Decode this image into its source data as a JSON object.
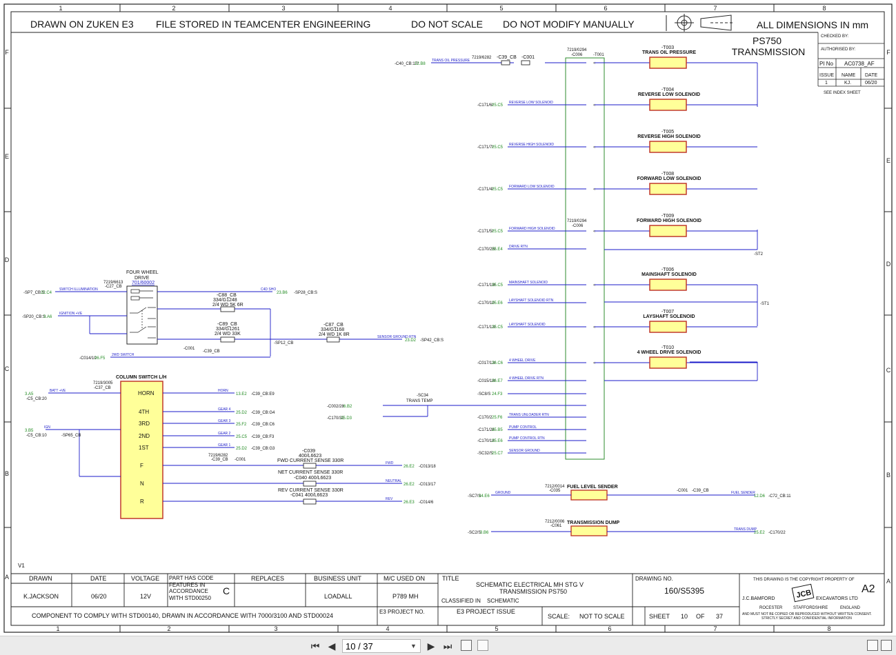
{
  "header": {
    "drawn_on": "DRAWN ON ZUKEN E3",
    "file_stored": "FILE STORED IN TEAMCENTER ENGINEERING",
    "do_not_scale": "DO NOT SCALE",
    "do_not_modify": "DO NOT MODIFY MANUALLY",
    "dimensions": "ALL DIMENSIONS IN mm"
  },
  "grid": {
    "cols": [
      "1",
      "2",
      "3",
      "4",
      "5",
      "6",
      "7",
      "8"
    ],
    "rows": [
      "F",
      "E",
      "D",
      "C",
      "B",
      "A"
    ]
  },
  "title_block": {
    "drawing_title_1": "PS750",
    "drawing_title_2": "TRANSMISSION",
    "checked_by": "CHECKED BY:",
    "authorised_by": "AUTHORISED BY:",
    "pi_no_label": "PI No",
    "pi_no": "AC0738_AF",
    "issue_label": "ISSUE",
    "name_label": "NAME",
    "date_label": "DATE",
    "issue": "1",
    "name": "KJ.",
    "date": "06/20",
    "see_index": "SEE INDEX SHEET",
    "drawn_label": "DRAWN",
    "date_col_label": "DATE",
    "voltage_label": "VOLTAGE",
    "part_code": "PART HAS CODE FEATURES IN ACCORDANCE WITH STD00250",
    "part_code_letter": "C",
    "replaces_label": "REPLACES",
    "business_unit_label": "BUSINESS UNIT",
    "mc_used_label": "M/C USED ON",
    "title_label": "TITLE",
    "drawn": "K.JACKSON",
    "drawn_date": "06/20",
    "voltage": "12V",
    "business_unit": "LOADALL",
    "mc_used": "P789 MH",
    "title_1": "SCHEMATIC ELECTRICAL MH STG V",
    "title_2": "TRANSMISSION PS750",
    "classified_in": "CLASSIFIED IN",
    "classified": "SCHEMATIC",
    "drawing_no_label": "DRAWING NO.",
    "drawing_no": "160/S5395",
    "sheet_size": "A2",
    "comply": "COMPONENT TO COMPLY WITH STD00140, DRAWN IN ACCORDANCE WITH 7000/3100 AND STD00024",
    "e3_project_no": "E3 PROJECT NO.",
    "e3_project_issue": "E3 PROJECT ISSUE",
    "scale_label": "SCALE:",
    "scale": "NOT TO SCALE",
    "sheet_label": "SHEET",
    "sheet": "10",
    "of_label": "OF",
    "sheet_total": "37",
    "copyright": "THIS DRAWING IS THE COPYRIGHT PROPERTY OF",
    "company_1": "J.C.BAMFORD",
    "company_2": "EXCAVATORS LTD",
    "address_1": "ROCESTER",
    "address_2": "STAFFORDSHIRE",
    "address_3": "ENGLAND",
    "notice_1": "AND MUST NOT BE COPIED OR REPRODUCED WITHOUT WRITTEN CONSENT.",
    "notice_2": "STRICTLY SECRET AND CONFIDENTIAL INFORMATION",
    "version": "V1",
    "logo_text": "JCB"
  },
  "components": {
    "c006_part": "7219/0294",
    "c006": "-C006",
    "t001": "-T001",
    "c006b_part": "7219/0294",
    "c006b": "-C006",
    "four_wheel_drive_1": "FOUR WHEEL",
    "four_wheel_drive_2": "DRIVE",
    "four_wheel_drive_ref": "701/60002",
    "c27_part": "7219/6613",
    "c27": "-C27_CB",
    "c88": "-C88_CB",
    "c88_part": "334/G1248",
    "c88_desc": "2/4 WD 5K 6R",
    "c89": "-C89_CB",
    "c89_part": "334/G1261",
    "c89_desc": "2/4 WD 33K",
    "c87": "-C87_CB",
    "c87_part": "334/G1168",
    "c87_desc": "2/4 WD 1K 8R",
    "column_switch": "COLUMN SWITCH L/H",
    "c37_part": "7219/3005",
    "c37": "-C37_CB",
    "cs_labels": [
      "HORN",
      "4TH",
      "3RD",
      "2ND",
      "1ST",
      "F",
      "N",
      "R"
    ],
    "c039": "-C039",
    "c039_part": "400/L6623",
    "c039_desc": "FWD CURRENT SENSE 330R",
    "c040_desc": "NET CURRENT SENSE 330R",
    "c040": "-C040  400/L6623",
    "c041": "REV CURRENT SENSE 330R",
    "c041_part": "-C041  400/L6623",
    "sc34": "-SC34",
    "trans_temp": "TRANS TEMP",
    "fuel_level": "FUEL LEVEL SENDER",
    "c035_part": "7212/0014",
    "c035": "-C035",
    "trans_dump": "TRANSMISSION DUMP",
    "c061_part": "7212/0006",
    "c061": "-C061",
    "c39_cb": "-C39_CB",
    "c001": "-C001"
  },
  "solenoids": [
    {
      "id": "-T003",
      "name": "TRANS OIL PRESSURE"
    },
    {
      "id": "-T004",
      "name": "REVERSE LOW SOLENOID"
    },
    {
      "id": "-T005",
      "name": "REVERSE HIGH SOLENOID"
    },
    {
      "id": "-T008",
      "name": "FORWARD LOW SOLENOID"
    },
    {
      "id": "-T009",
      "name": "FORWARD HIGH SOLENOID"
    },
    {
      "id": "-T006",
      "name": "MAINSHAFT SOLENOID"
    },
    {
      "id": "-T007",
      "name": "LAYSHAFT SOLENOID"
    },
    {
      "id": "-T010",
      "name": "4 WHEEL DRIVE SOLENOID"
    }
  ],
  "left_refs": [
    {
      "pre": "-C171/6/",
      "ref": "25.C5",
      "sig": "REVERSE LOW SOLENOID"
    },
    {
      "pre": "-C171/7/",
      "ref": "25.C5",
      "sig": "REVERSE HIGH SOLENOID"
    },
    {
      "pre": "-C171/4/",
      "ref": "25.C5",
      "sig": "FORWARD LOW SOLENOID"
    },
    {
      "pre": "-C171/5/",
      "ref": "25.C5",
      "sig": "FORWARD HIGH SOLENOID"
    },
    {
      "pre": "-C170/25/",
      "ref": "25.E4",
      "sig": "DRIVE RTN"
    },
    {
      "pre": "-C171/19/",
      "ref": "25.C5",
      "sig": "MAINSHAFT SOLENOID"
    },
    {
      "pre": "-C170/10",
      "ref": "25.E6",
      "sig": "LAYSHAFT SOLENOID RTN"
    },
    {
      "pre": "-C171/13/",
      "ref": "25.C5",
      "sig": "LAYSHAFT SOLENOID"
    },
    {
      "pre": "-C017/13/",
      "ref": "26.C6",
      "sig": "4 WHEEL DRIVE"
    },
    {
      "pre": "-C015/18/",
      "ref": "26.E7",
      "sig": "4 WHEEL DRIVE RTN"
    },
    {
      "pre": "-SC8/S",
      "ref": "24.F3",
      "sig": ""
    },
    {
      "pre": "",
      "ref": "",
      "sig": ""
    },
    {
      "pre": "-C170/2",
      "ref": "25.F6",
      "sig": "TRANS UNLOADER RTN"
    },
    {
      "pre": "-C171/26",
      "ref": "25.B5",
      "sig": "PUMP CONTROL"
    },
    {
      "pre": "-C170/18",
      "ref": "25.E6",
      "sig": "PUMP CONTROL RTN"
    },
    {
      "pre": "-SC32/S",
      "ref": "25.C7",
      "sig": "SENSOR GROUND"
    }
  ],
  "misc_refs": {
    "c40_ref_pre": "-C40_CB:17/",
    "c40_ref": "12.B8",
    "c40_sig": "TRANS OIL PRESSURE",
    "c39_top_part": "7219/6282",
    "c39_top": "-C39_CB",
    "c001_top": "-C001",
    "st2": "-ST2",
    "st1": "-ST1",
    "sp7_pre": "-SP7_CB:S",
    "sp7_ref": "22.C4",
    "sp7_sig": "SWITCH ILLUMINATION",
    "sp20_pre": "-SP20_CB:S",
    "sp20_ref": "3.A6",
    "sp20_sig": "IGNITION +VE",
    "c014_pre": "-C014/10",
    "c014_ref": "26.F5",
    "c014_sig": "2WD SWITCH",
    "b23_ref": "23.B6",
    "b23_post": "-SP28_CB:S",
    "b23_sig": "C4D SHO",
    "sp12": "-SP12_CB",
    "sensor_ground": "SENSOR GROUND RTN",
    "d2_ref": "23.D2",
    "d2_post": "-SP42_CB:S",
    "batt_ref": "3.A5",
    "batt_sig": "BATT +VE",
    "c5_cb20": "-C5_CB:20",
    "b5_ref": "3.B5",
    "c5_cb10": "-C5_CB:10",
    "ign": "IGN",
    "sp65": "-SP65_CB",
    "horn_ref": "13.E2",
    "horn_post": "-C39_CB:E9",
    "horn_sig": "HORN",
    "gear4_ref": "25.D2",
    "gear4_post": "-C39_CB:G4",
    "gear4_sig": "GEAR 4",
    "gear3_ref": "25.F2",
    "gear3_post": "-C39_CB:C6",
    "gear3_sig": "GEAR 3",
    "gear2_ref": "25.C5",
    "gear2_post": "-C39_CB:F3",
    "gear2_sig": "GEAR 2",
    "gear1_ref": "25.D2",
    "gear1_post": "-C39_CB:G3",
    "gear1_sig": "GEAR 1",
    "fwd_ref": "26.E2",
    "fwd_post": "-C013/18",
    "fwd_sig": "FWD",
    "neut_ref": "26.E2",
    "neut_post": "-C013/17",
    "neut_sig": "NEUTRAL",
    "rev_ref": "26.E3",
    "rev_post": "-C014/6",
    "rev_sig": "REV",
    "c002_pre": "-C002/28",
    "c002_ref": "6.B2",
    "c170_pre": "-C170/32",
    "c170_ref": "25.D3",
    "sc7_pre": "-SC7/S",
    "sc7_ref": "24.E6",
    "sc7_sig": "GROUND",
    "fuel_sender_sig": "FUEL SENDER",
    "fuel_ref": "12.D6",
    "fuel_post": "-C72_CB:11",
    "sc2_pre": "-SC2/S",
    "sc2_ref": "3.B6",
    "trans_dump_sig": "TRANS DUMP",
    "dump_ref": "25.E2",
    "dump_post": "-C170/22"
  },
  "viewer": {
    "page_value": "10 / 37",
    "icons": [
      "first-page-icon",
      "prev-page-icon",
      "next-page-icon",
      "last-page-icon",
      "fit-page-icon",
      "fit-width-icon",
      "single-page-icon",
      "continuous-icon"
    ]
  }
}
